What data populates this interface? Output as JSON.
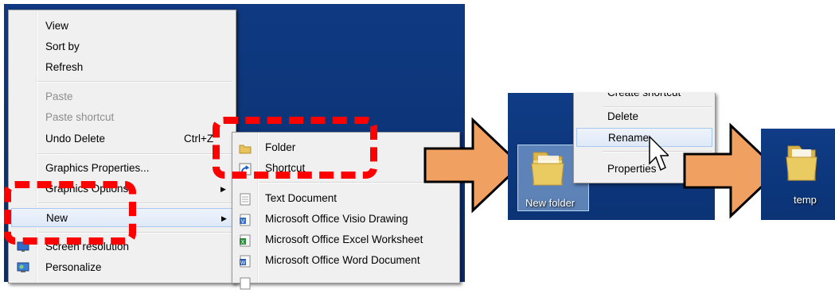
{
  "context_menu": {
    "items": [
      {
        "label": "View",
        "disabled": false
      },
      {
        "label": "Sort by",
        "disabled": false
      },
      {
        "label": "Refresh",
        "disabled": false
      },
      {
        "label": "Paste",
        "disabled": true
      },
      {
        "label": "Paste shortcut",
        "disabled": true
      },
      {
        "label": "Undo Delete",
        "disabled": false,
        "shortcut": "Ctrl+Z"
      },
      {
        "label": "Graphics Properties...",
        "disabled": false
      },
      {
        "label": "Graphics Options",
        "disabled": false
      },
      {
        "label": "New",
        "disabled": false
      },
      {
        "label": "Screen resolution",
        "disabled": false
      },
      {
        "label": "Personalize",
        "disabled": false
      }
    ]
  },
  "new_submenu": {
    "items": [
      {
        "label": "Folder",
        "icon": "folder-icon"
      },
      {
        "label": "Shortcut",
        "icon": "shortcut-icon"
      },
      {
        "label": "Text Document",
        "icon": "text-document-icon"
      },
      {
        "label": "Microsoft Office Visio Drawing",
        "icon": "visio-icon"
      },
      {
        "label": "Microsoft Office Excel Worksheet",
        "icon": "excel-icon"
      },
      {
        "label": "Microsoft Office Word Document",
        "icon": "word-icon"
      }
    ]
  },
  "file_menu": {
    "items": [
      {
        "label": "Create shortcut"
      },
      {
        "label": "Delete"
      },
      {
        "label": "Rename"
      },
      {
        "label": "Properties"
      }
    ]
  },
  "desktop_items": {
    "new_folder_label": "New folder",
    "renamed_folder_label": "temp"
  },
  "colors": {
    "desktop_blue": "#0c3479",
    "highlight_red": "#ff0000",
    "step_arrow_orange": "#f0a060"
  }
}
